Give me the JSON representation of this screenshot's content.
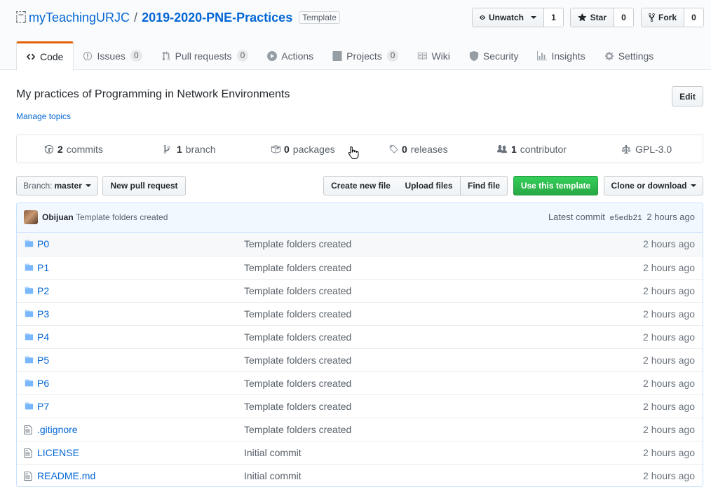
{
  "repo": {
    "owner": "myTeachingURJC",
    "separator": "/",
    "name": "2019-2020-PNE-Practices",
    "badge": "Template"
  },
  "actions": {
    "watch_label": "Unwatch",
    "watch_count": "1",
    "star_label": "Star",
    "star_count": "0",
    "fork_label": "Fork",
    "fork_count": "0"
  },
  "tabs": [
    {
      "label": "Code",
      "icon": "code-icon",
      "selected": true
    },
    {
      "label": "Issues",
      "icon": "issue-icon",
      "counter": "0"
    },
    {
      "label": "Pull requests",
      "icon": "pull-request-icon",
      "counter": "0"
    },
    {
      "label": "Actions",
      "icon": "play-icon"
    },
    {
      "label": "Projects",
      "icon": "project-icon",
      "counter": "0"
    },
    {
      "label": "Wiki",
      "icon": "book-icon"
    },
    {
      "label": "Security",
      "icon": "shield-icon"
    },
    {
      "label": "Insights",
      "icon": "graph-icon"
    },
    {
      "label": "Settings",
      "icon": "gear-icon"
    }
  ],
  "about": {
    "description": "My practices of Programming in Network Environments",
    "manage_topics": "Manage topics",
    "edit_label": "Edit"
  },
  "summary": {
    "commits_count": "2",
    "commits_label": "commits",
    "branch_count": "1",
    "branch_label": "branch",
    "packages_count": "0",
    "packages_label": "packages",
    "releases_count": "0",
    "releases_label": "releases",
    "contributor_count": "1",
    "contributor_label": "contributor",
    "license": "GPL-3.0"
  },
  "file_nav": {
    "branch_prefix": "Branch:",
    "branch_name": "master",
    "new_pr": "New pull request",
    "create_file": "Create new file",
    "upload_files": "Upload files",
    "find_file": "Find file",
    "use_template": "Use this template",
    "clone": "Clone or download"
  },
  "commit": {
    "author": "Obijuan",
    "message": "Template folders created",
    "latest_label": "Latest commit",
    "sha": "e5edb21",
    "age": "2 hours ago"
  },
  "files": [
    {
      "name": "P0",
      "type": "folder",
      "message": "Template folders created",
      "age": "2 hours ago"
    },
    {
      "name": "P1",
      "type": "folder",
      "message": "Template folders created",
      "age": "2 hours ago"
    },
    {
      "name": "P2",
      "type": "folder",
      "message": "Template folders created",
      "age": "2 hours ago"
    },
    {
      "name": "P3",
      "type": "folder",
      "message": "Template folders created",
      "age": "2 hours ago"
    },
    {
      "name": "P4",
      "type": "folder",
      "message": "Template folders created",
      "age": "2 hours ago"
    },
    {
      "name": "P5",
      "type": "folder",
      "message": "Template folders created",
      "age": "2 hours ago"
    },
    {
      "name": "P6",
      "type": "folder",
      "message": "Template folders created",
      "age": "2 hours ago"
    },
    {
      "name": "P7",
      "type": "folder",
      "message": "Template folders created",
      "age": "2 hours ago"
    },
    {
      "name": ".gitignore",
      "type": "file",
      "message": "Template folders created",
      "age": "2 hours ago"
    },
    {
      "name": "LICENSE",
      "type": "file",
      "message": "Initial commit",
      "age": "2 hours ago"
    },
    {
      "name": "README.md",
      "type": "file",
      "message": "Initial commit",
      "age": "2 hours ago"
    }
  ],
  "colors": {
    "link": "#0366d6",
    "accent_tab": "#e36209",
    "green_button": "#28a745",
    "folder_icon": "#79b8ff"
  }
}
